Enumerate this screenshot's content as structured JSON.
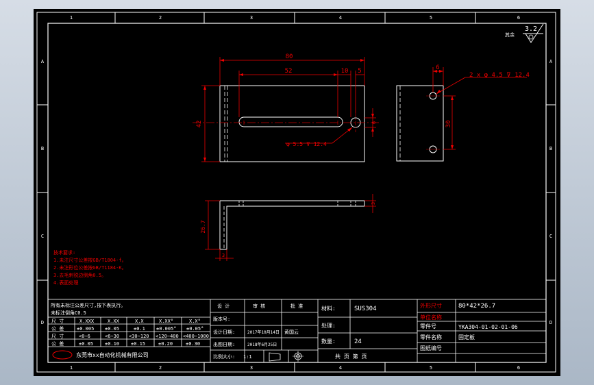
{
  "frame": {
    "col_labels": [
      "1",
      "2",
      "3",
      "4",
      "5",
      "6"
    ],
    "row_labels": [
      "A",
      "B",
      "C",
      "D"
    ]
  },
  "roughness": {
    "label": "其余",
    "value": "3.2"
  },
  "dims": {
    "total_width": "80",
    "slot_length": "52",
    "d10": "10",
    "d5": "5",
    "height": "42",
    "slot_width": "6",
    "hole_callout": "φ 5.5 ⊽ 12.4",
    "side_offset": "6",
    "hole_pattern": "2 x φ 4.5 ⊽ 12.4",
    "hole_spacing": "30",
    "bend_height": "26.7",
    "thickness_bottom": "3",
    "thickness_top": "3"
  },
  "tech_notes": {
    "title": "技术要求:",
    "lines": [
      "1.未注尺寸公差按GB/T1804-f。",
      "2.未注形位公差按GB/T1184-K。",
      "3.去毛刺锐边倒角0.5。",
      "4.表面处理"
    ]
  },
  "tolerance_block": {
    "note_lines": [
      "所有未标注公差尺寸,按下表执行。",
      "未标注倒角C0.5"
    ],
    "headers": [
      "尺 寸",
      "X.XXX",
      "X.XX",
      "X.X",
      "X.XX°",
      "X.X°"
    ],
    "rows": [
      [
        "公 差",
        "±0.005",
        "±0.05",
        "±0.1",
        "±0.005°",
        "±0.05°"
      ],
      [
        "尺 寸",
        "<0~6",
        "<6~30",
        "<30~120",
        "<120~400",
        "<400~1000"
      ],
      [
        "公 差",
        "±0.05",
        "±0.10",
        "±0.15",
        "±0.20",
        "±0.30"
      ]
    ],
    "company": "东莞市xx自动化机械有限公司"
  },
  "signoff": {
    "headers": [
      "设 计",
      "审 核",
      "批 准"
    ],
    "edition_label": "版本号:",
    "design_date_label": "设计日期:",
    "design_date_value": "2017年10月14日",
    "design_name": "黄国云",
    "print_date_label": "出图日期:",
    "print_date_value": "2018年6月25日",
    "scale_label": "比例大小:",
    "scale_value": "1:1"
  },
  "material_block": {
    "material_label": "材料:",
    "material_value": "SUS304",
    "treatment_label": "处理:",
    "treatment_value": "",
    "quantity_label": "数量:",
    "quantity_value": "24",
    "footer": "共 页   第 页"
  },
  "info_block": {
    "spec_label": "外形尺寸",
    "spec_value": "80*42*26.7",
    "unit_label": "单位名称",
    "unit_value": "",
    "part_no_label": "零件号",
    "part_no_value": "YKA304-01-02-01-06",
    "part_name_label": "零件名称",
    "part_name_value": "固定板",
    "drawing_no_label": "图纸编号",
    "drawing_no_value": ""
  }
}
